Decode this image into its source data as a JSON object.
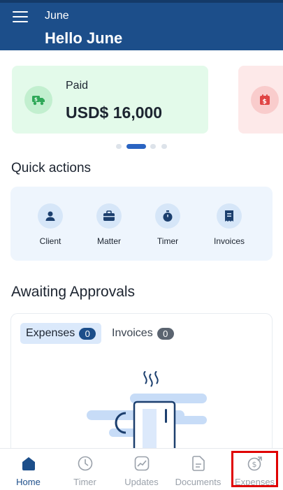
{
  "header": {
    "menu_icon": "hamburger-menu-icon",
    "user_name": "June",
    "greeting": "Hello June",
    "background": "#1c4e8a"
  },
  "carousel": {
    "cards": [
      {
        "label": "Paid",
        "value": "USD$ 16,000",
        "icon": "money-truck-icon",
        "color": "#e3faea"
      },
      {
        "label": "",
        "value": "",
        "icon": "calendar-dollar-icon",
        "color": "#fde9e9"
      }
    ],
    "active_index": 1,
    "dot_count": 4
  },
  "quick_actions": {
    "title": "Quick actions",
    "items": [
      {
        "label": "Client",
        "icon": "person-icon"
      },
      {
        "label": "Matter",
        "icon": "briefcase-icon"
      },
      {
        "label": "Timer",
        "icon": "stopwatch-icon"
      },
      {
        "label": "Invoices",
        "icon": "invoice-icon"
      }
    ]
  },
  "approvals": {
    "title": "Awaiting Approvals",
    "tabs": [
      {
        "label": "Expenses",
        "count": "0",
        "selected": true
      },
      {
        "label": "Invoices",
        "count": "0",
        "selected": false
      }
    ],
    "illustration": "coffee-mug-empty-state"
  },
  "bottom_nav": {
    "items": [
      {
        "label": "Home",
        "icon": "home-icon",
        "active": true
      },
      {
        "label": "Timer",
        "icon": "clock-icon",
        "active": false
      },
      {
        "label": "Updates",
        "icon": "trend-chart-icon",
        "active": false
      },
      {
        "label": "Documents",
        "icon": "document-icon",
        "active": false
      },
      {
        "label": "Expenses",
        "icon": "dollar-circle-arrow-icon",
        "active": false,
        "highlighted": true
      }
    ]
  },
  "colors": {
    "accent": "#1c4e8a",
    "highlight": "#e00000",
    "inactive": "#9aa1aa"
  }
}
